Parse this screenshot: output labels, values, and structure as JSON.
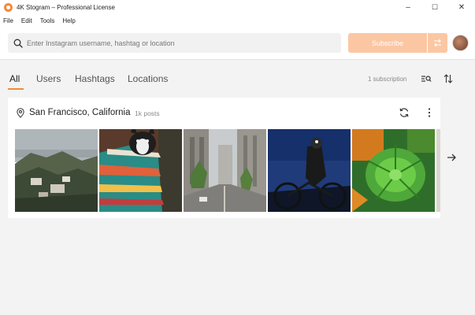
{
  "window": {
    "title": "4K Stogram – Professional License",
    "controls": {
      "minimize": "–",
      "maximize": "☐",
      "close": "✕"
    }
  },
  "menu": [
    "File",
    "Edit",
    "Tools",
    "Help"
  ],
  "search": {
    "placeholder": "Enter Instagram username, hashtag or location",
    "value": ""
  },
  "subscribe_label": "Subscribe",
  "tabs": [
    {
      "label": "All",
      "active": true
    },
    {
      "label": "Users",
      "active": false
    },
    {
      "label": "Hashtags",
      "active": false
    },
    {
      "label": "Locations",
      "active": false
    }
  ],
  "subscription_count": "1 subscription",
  "subscription": {
    "name": "San Francisco, California",
    "posts": "1k posts",
    "thumbnails": [
      "coastal-town-photo",
      "dog-in-blanket-photo",
      "city-street-photo",
      "cyclist-at-night-photo",
      "green-plant-photo"
    ]
  },
  "colors": {
    "accent": "#f08a3c",
    "subscribe_disabled": "#fbc7a3"
  }
}
